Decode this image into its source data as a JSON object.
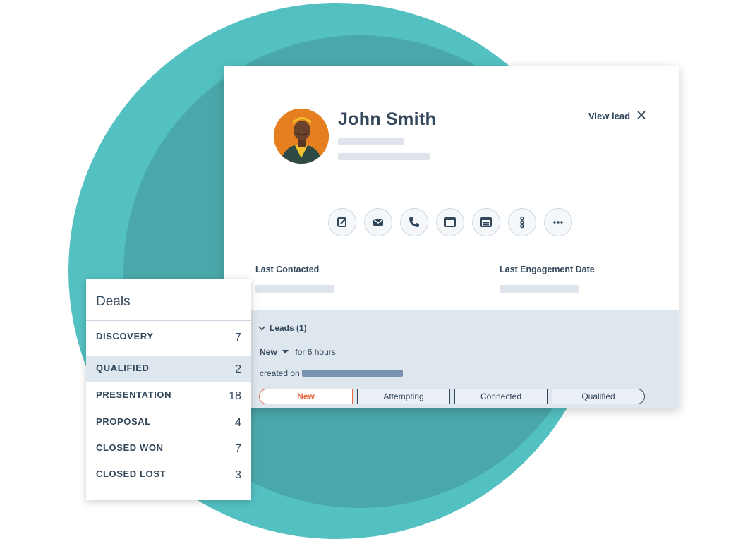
{
  "contact": {
    "name": "John Smith",
    "view_lead_label": "View lead",
    "close_label": "✕"
  },
  "properties": {
    "last_contacted_label": "Last Contacted",
    "last_engagement_label": "Last Engagement Date"
  },
  "actions": [
    {
      "icon": "note-icon"
    },
    {
      "icon": "email-icon"
    },
    {
      "icon": "call-icon"
    },
    {
      "icon": "task-icon"
    },
    {
      "icon": "meeting-icon"
    },
    {
      "icon": "sequence-icon"
    },
    {
      "icon": "more-icon"
    }
  ],
  "leads": {
    "header": "Leads (1)",
    "stage": "New",
    "duration": "for 6 hours",
    "created_label": "created on",
    "pipeline": [
      "New",
      "Attempting",
      "Connected",
      "Qualified"
    ]
  },
  "deals": {
    "title": "Deals",
    "items": [
      {
        "label": "DISCOVERY",
        "count": "7"
      },
      {
        "label": "QUALIFIED",
        "count": "2"
      },
      {
        "label": "PRESENTATION",
        "count": "18"
      },
      {
        "label": "PROPOSAL",
        "count": "4"
      },
      {
        "label": "CLOSED WON",
        "count": "7"
      },
      {
        "label": "CLOSED LOST",
        "count": "3"
      }
    ]
  },
  "colors": {
    "teal_outer": "#53c0c2",
    "teal_inner": "#4aa8aa",
    "text": "#33475b",
    "accent": "#e8683f",
    "avatar_bg": "#e57f20"
  }
}
